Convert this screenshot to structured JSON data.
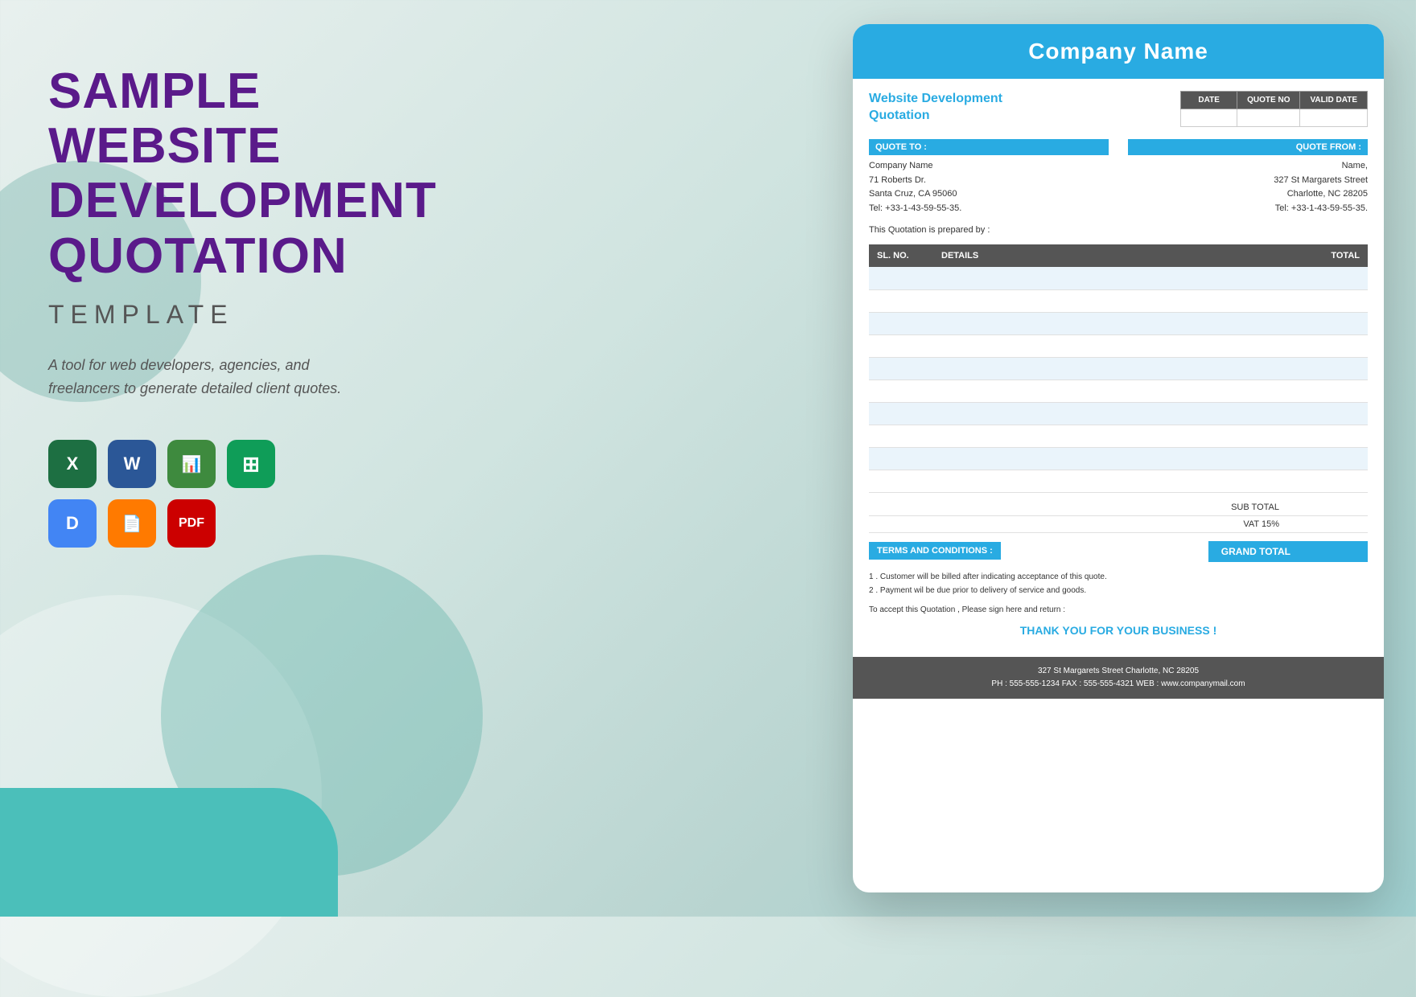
{
  "background": {
    "color": "#d8ecea"
  },
  "left_panel": {
    "main_title": "SAMPLE WEBSITE DEVELOPMENT QUOTATION",
    "sub_title": "TEMPLATE",
    "description": "A tool for web developers, agencies, and freelancers to generate detailed client quotes.",
    "icons": [
      {
        "id": "excel",
        "label": "X",
        "sub": "",
        "class": "icon-excel"
      },
      {
        "id": "word",
        "label": "W",
        "sub": "",
        "class": "icon-word"
      },
      {
        "id": "numbers",
        "label": "N",
        "sub": "",
        "class": "icon-numbers"
      },
      {
        "id": "sheets",
        "label": "G",
        "sub": "",
        "class": "icon-sheets"
      },
      {
        "id": "docs",
        "label": "D",
        "sub": "",
        "class": "icon-docs"
      },
      {
        "id": "pages",
        "label": "P",
        "sub": "",
        "class": "icon-pages"
      },
      {
        "id": "pdf",
        "label": "PDF",
        "sub": "",
        "class": "icon-pdf"
      }
    ]
  },
  "document": {
    "header_title": "Company Name",
    "quote_title": "Website Development\nQuotation",
    "date_headers": [
      "DATE",
      "QUOTE NO",
      "VALID DATE"
    ],
    "quote_to_header": "QUOTE TO :",
    "quote_from_header": "QUOTE FROM :",
    "quote_to": {
      "company": "Company Name",
      "address1": "71 Roberts Dr.",
      "address2": "Santa Cruz, CA 95060",
      "tel": "Tel: +33-1-43-59-55-35."
    },
    "quote_from": {
      "name": "Name,",
      "address1": "327 St Margarets Street",
      "address2": "Charlotte, NC 28205",
      "tel": "Tel: +33-1-43-59-55-35."
    },
    "prepared_by": "This Quotation is prepared by :",
    "table_headers": [
      "SL. NO.",
      "DETAILS",
      "TOTAL"
    ],
    "table_rows": [
      {
        "sl": "",
        "details": "",
        "total": ""
      },
      {
        "sl": "",
        "details": "",
        "total": ""
      },
      {
        "sl": "",
        "details": "",
        "total": ""
      },
      {
        "sl": "",
        "details": "",
        "total": ""
      },
      {
        "sl": "",
        "details": "",
        "total": ""
      },
      {
        "sl": "",
        "details": "",
        "total": ""
      },
      {
        "sl": "",
        "details": "",
        "total": ""
      },
      {
        "sl": "",
        "details": "",
        "total": ""
      },
      {
        "sl": "",
        "details": "",
        "total": ""
      },
      {
        "sl": "",
        "details": "",
        "total": ""
      }
    ],
    "sub_total_label": "SUB TOTAL",
    "vat_label": "VAT 15%",
    "grand_total_label": "GRAND TOTAL",
    "terms_header": "TERMS AND CONDITIONS :",
    "terms": [
      "1. Customer will be billed after indicating acceptance of this quote.",
      "2. Payment will be due prior to delivery of service and goods."
    ],
    "sign_text": "To accept this Quotation , Please sign here and return :",
    "thank_you": "THANK YOU FOR YOUR BUSINESS !",
    "footer_address": "327 St Margarets Street Charlotte, NC 28205",
    "footer_phone": "PH : 555-555-1234   FAX : 555-555-4321   WEB : www.companymail.com"
  }
}
